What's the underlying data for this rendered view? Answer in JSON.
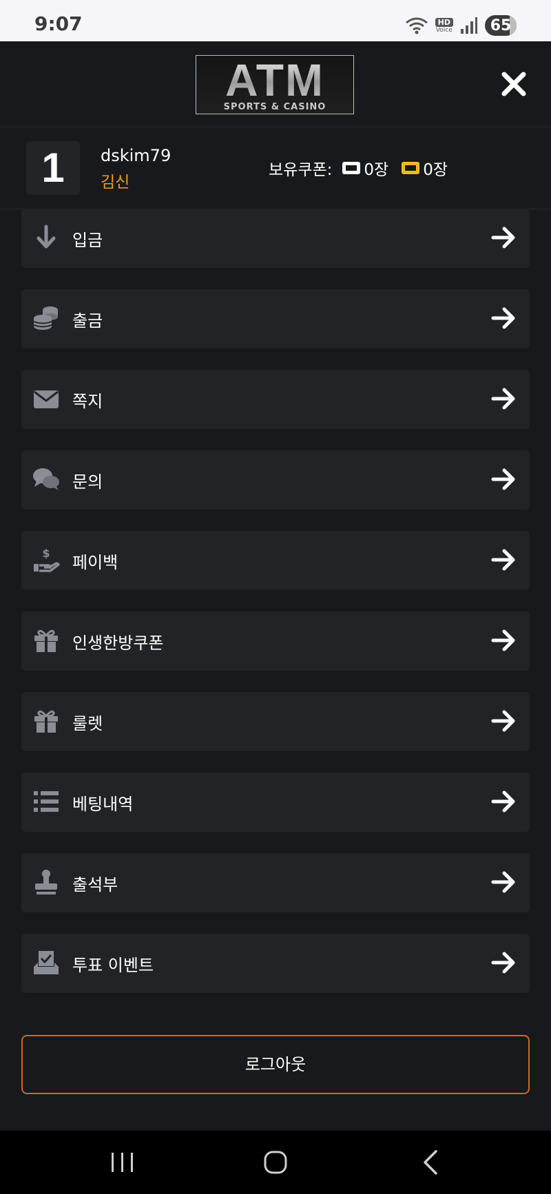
{
  "status_bar": {
    "time": "9:07",
    "hd_label": "HD",
    "voice_label": "Voice",
    "battery": "65"
  },
  "header": {
    "logo_main": "ATM",
    "logo_sub": "SPORTS & CASINO"
  },
  "user": {
    "level": "1",
    "username": "dskim79",
    "nickname": "김신",
    "coupon_label": "보유쿠폰:",
    "coupon_white_count": "0장",
    "coupon_gold_count": "0장"
  },
  "colors": {
    "accent_orange": "#f39a1c",
    "logout_border": "#e0621b",
    "background": "#18191c",
    "card": "#222327"
  },
  "menu": [
    {
      "label": "입금",
      "icon": "arrow-down-icon"
    },
    {
      "label": "출금",
      "icon": "coins-icon"
    },
    {
      "label": "쪽지",
      "icon": "envelope-icon"
    },
    {
      "label": "문의",
      "icon": "comments-icon"
    },
    {
      "label": "페이백",
      "icon": "hand-dollar-icon"
    },
    {
      "label": "인생한방쿠폰",
      "icon": "gift-icon"
    },
    {
      "label": "룰렛",
      "icon": "gift-icon"
    },
    {
      "label": "베팅내역",
      "icon": "list-icon"
    },
    {
      "label": "출석부",
      "icon": "stamp-icon"
    },
    {
      "label": "투표 이벤트",
      "icon": "vote-box-icon"
    }
  ],
  "logout_label": "로그아웃"
}
